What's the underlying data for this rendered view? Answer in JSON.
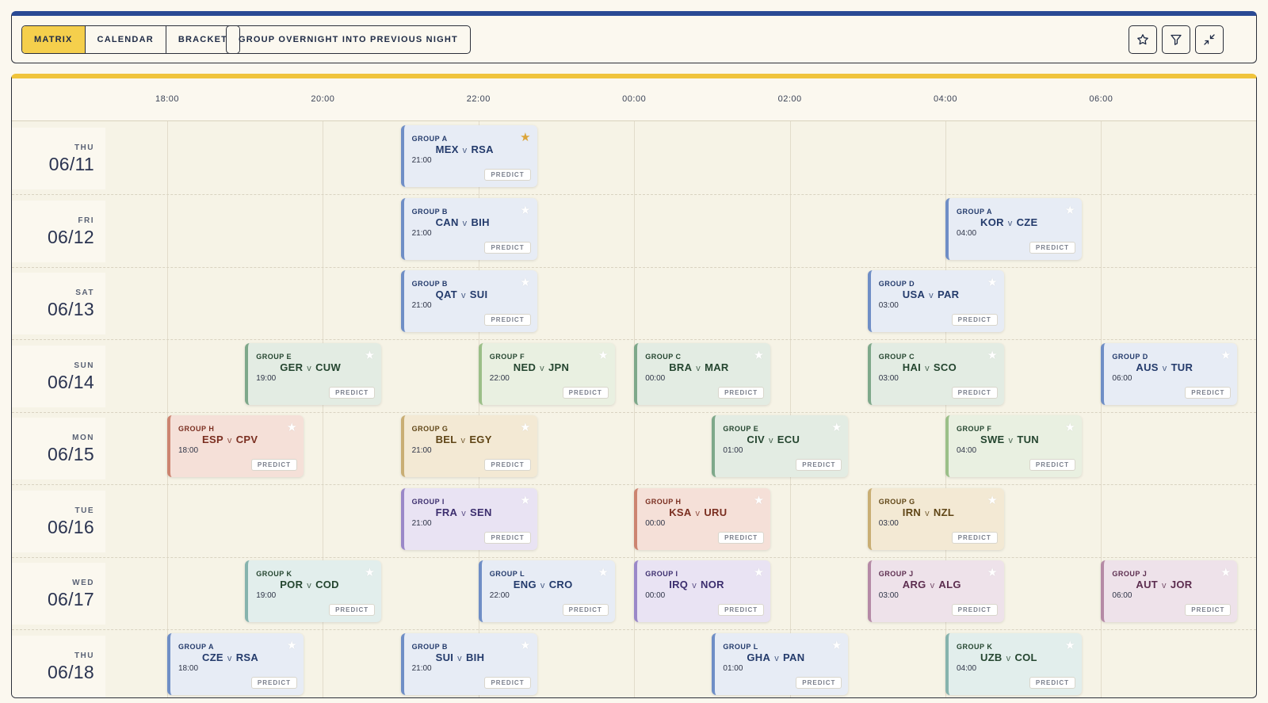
{
  "toolbar": {
    "views": [
      "MATRIX",
      "CALENDAR",
      "BRACKET"
    ],
    "active_view": "MATRIX",
    "overnight_toggle": "GROUP OVERNIGHT INTO PREVIOUS NIGHT",
    "icons": [
      "star-icon",
      "filter-icon",
      "collapse-icon"
    ]
  },
  "timeline": {
    "ticks": [
      "18:00",
      "20:00",
      "22:00",
      "00:00",
      "02:00",
      "04:00",
      "06:00"
    ]
  },
  "days": [
    {
      "dow": "THU",
      "date": "06/11",
      "matches": [
        {
          "group": "GROUP A",
          "home": "MEX",
          "away": "RSA",
          "time": "21:00",
          "color": "blue",
          "starred": true
        }
      ]
    },
    {
      "dow": "FRI",
      "date": "06/12",
      "matches": [
        {
          "group": "GROUP B",
          "home": "CAN",
          "away": "BIH",
          "time": "21:00",
          "color": "blue",
          "starred": false
        },
        {
          "group": "GROUP A",
          "home": "KOR",
          "away": "CZE",
          "time": "04:00",
          "color": "blue",
          "starred": false
        }
      ]
    },
    {
      "dow": "SAT",
      "date": "06/13",
      "matches": [
        {
          "group": "GROUP B",
          "home": "QAT",
          "away": "SUI",
          "time": "21:00",
          "color": "blue",
          "starred": false
        },
        {
          "group": "GROUP D",
          "home": "USA",
          "away": "PAR",
          "time": "03:00",
          "color": "blue",
          "starred": false
        }
      ]
    },
    {
      "dow": "SUN",
      "date": "06/14",
      "matches": [
        {
          "group": "GROUP E",
          "home": "GER",
          "away": "CUW",
          "time": "19:00",
          "color": "green",
          "starred": false
        },
        {
          "group": "GROUP F",
          "home": "NED",
          "away": "JPN",
          "time": "22:00",
          "color": "lgreen",
          "starred": false
        },
        {
          "group": "GROUP C",
          "home": "BRA",
          "away": "MAR",
          "time": "00:00",
          "color": "green",
          "starred": false
        },
        {
          "group": "GROUP C",
          "home": "HAI",
          "away": "SCO",
          "time": "03:00",
          "color": "green",
          "starred": false
        },
        {
          "group": "GROUP D",
          "home": "AUS",
          "away": "TUR",
          "time": "06:00",
          "color": "blue",
          "starred": false
        }
      ]
    },
    {
      "dow": "MON",
      "date": "06/15",
      "matches": [
        {
          "group": "GROUP H",
          "home": "ESP",
          "away": "CPV",
          "time": "18:00",
          "color": "red",
          "starred": false
        },
        {
          "group": "GROUP G",
          "home": "BEL",
          "away": "EGY",
          "time": "21:00",
          "color": "tan",
          "starred": false
        },
        {
          "group": "GROUP E",
          "home": "CIV",
          "away": "ECU",
          "time": "01:00",
          "color": "green",
          "starred": false
        },
        {
          "group": "GROUP F",
          "home": "SWE",
          "away": "TUN",
          "time": "04:00",
          "color": "lgreen",
          "starred": false
        }
      ]
    },
    {
      "dow": "TUE",
      "date": "06/16",
      "matches": [
        {
          "group": "GROUP I",
          "home": "FRA",
          "away": "SEN",
          "time": "21:00",
          "color": "purple",
          "starred": false
        },
        {
          "group": "GROUP H",
          "home": "KSA",
          "away": "URU",
          "time": "00:00",
          "color": "red",
          "starred": false
        },
        {
          "group": "GROUP G",
          "home": "IRN",
          "away": "NZL",
          "time": "03:00",
          "color": "tan",
          "starred": false
        }
      ]
    },
    {
      "dow": "WED",
      "date": "06/17",
      "matches": [
        {
          "group": "GROUP K",
          "home": "POR",
          "away": "COD",
          "time": "19:00",
          "color": "teal",
          "starred": false
        },
        {
          "group": "GROUP L",
          "home": "ENG",
          "away": "CRO",
          "time": "22:00",
          "color": "blue",
          "starred": false
        },
        {
          "group": "GROUP I",
          "home": "IRQ",
          "away": "NOR",
          "time": "00:00",
          "color": "purple",
          "starred": false
        },
        {
          "group": "GROUP J",
          "home": "ARG",
          "away": "ALG",
          "time": "03:00",
          "color": "mauve",
          "starred": false
        },
        {
          "group": "GROUP J",
          "home": "AUT",
          "away": "JOR",
          "time": "06:00",
          "color": "mauve",
          "starred": false
        }
      ]
    },
    {
      "dow": "THU",
      "date": "06/18",
      "matches": [
        {
          "group": "GROUP A",
          "home": "CZE",
          "away": "RSA",
          "time": "18:00",
          "color": "blue",
          "starred": false
        },
        {
          "group": "GROUP B",
          "home": "SUI",
          "away": "BIH",
          "time": "21:00",
          "color": "blue",
          "starred": false
        },
        {
          "group": "GROUP L",
          "home": "GHA",
          "away": "PAN",
          "time": "01:00",
          "color": "blue",
          "starred": false
        },
        {
          "group": "GROUP K",
          "home": "UZB",
          "away": "COL",
          "time": "04:00",
          "color": "teal",
          "starred": false
        }
      ]
    }
  ],
  "labels": {
    "versus": "v",
    "predict": "PREDICT",
    "star_glyph": "★"
  },
  "colors": {
    "header_accent": "#2a4a94",
    "board_accent": "#f0c43c",
    "active_tab": "#f5cf4c",
    "favorite_star": "#dba53a"
  }
}
